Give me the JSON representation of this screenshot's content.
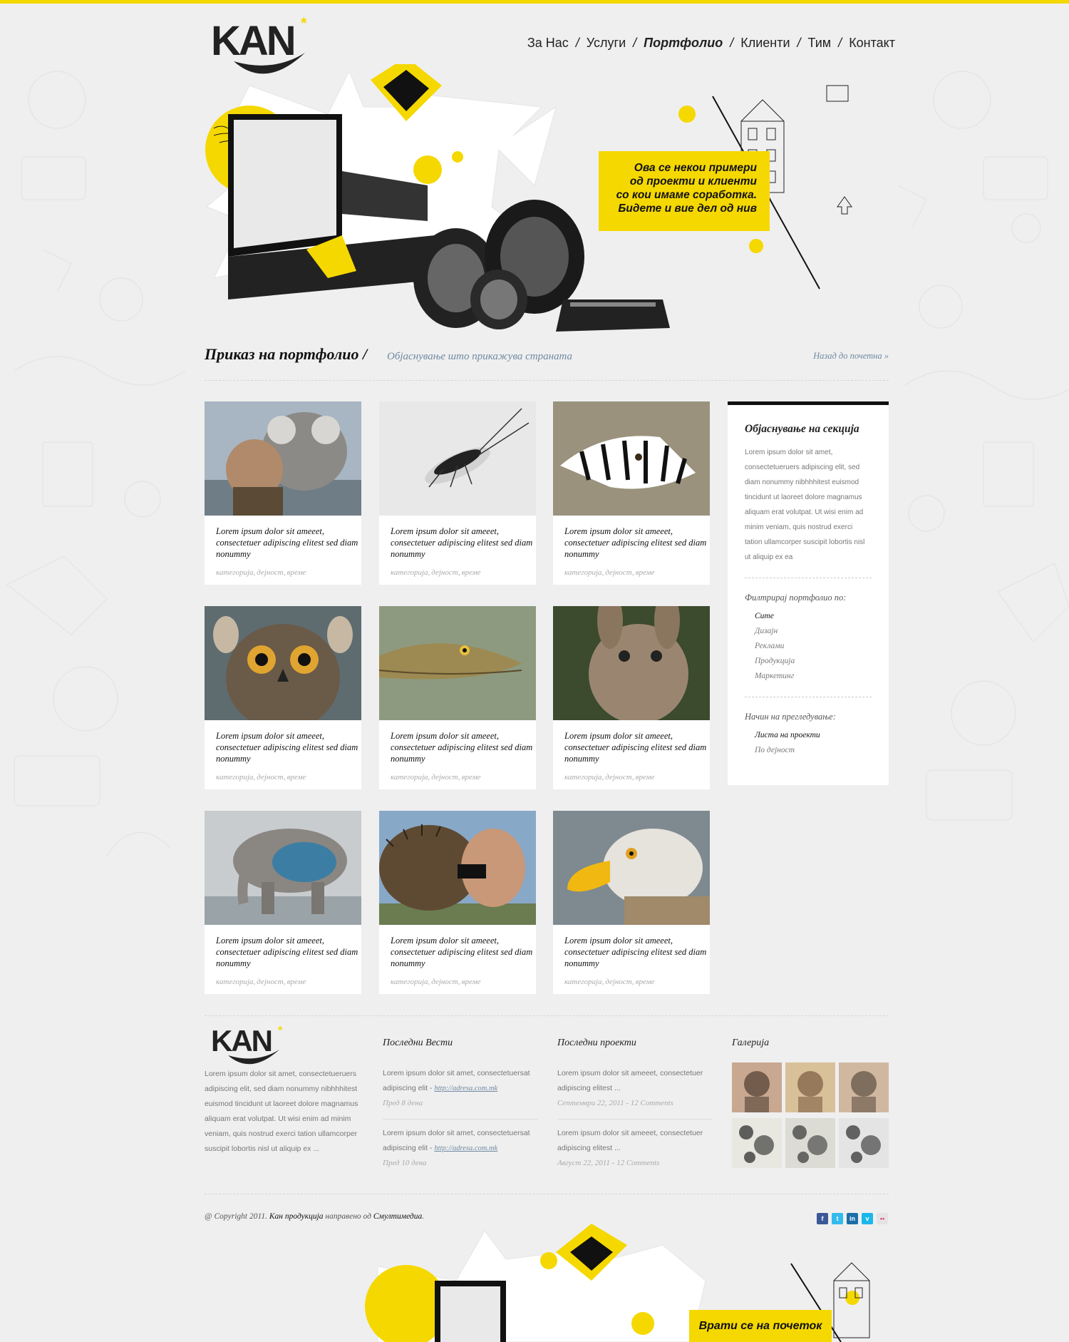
{
  "brand": {
    "logo_text": "KAN",
    "accent": "#f5d800"
  },
  "nav": {
    "items": [
      {
        "label": "За Нас",
        "active": false
      },
      {
        "label": "Услуги",
        "active": false
      },
      {
        "label": "Портфолио",
        "active": true
      },
      {
        "label": "Клиенти",
        "active": false
      },
      {
        "label": "Тим",
        "active": false
      },
      {
        "label": "Контакт",
        "active": false
      }
    ],
    "separator": "/"
  },
  "hero": {
    "callout_lines": [
      "Ова се некои примери",
      "од проекти и клиенти",
      "со кои имаме соработка.",
      "Бидете и вие дел од нив"
    ]
  },
  "section": {
    "title": "Приказ на портфолио /",
    "subtitle": "Објаснување што прикажува страната",
    "back_link": "Назад до почетна »"
  },
  "portfolio": {
    "items": [
      {
        "title": "Lorem ipsum dolor sit ameeet, consectetuer adipiscing elitest sed diam nonummy",
        "meta": [
          "категорија,",
          "дејност,",
          "време"
        ],
        "image": "koala"
      },
      {
        "title": "Lorem ipsum dolor sit ameeet, consectetuer adipiscing elitest sed diam nonummy",
        "meta": [
          "категорија,",
          "дејност,",
          "време"
        ],
        "image": "insect"
      },
      {
        "title": "Lorem ipsum dolor sit ameeet, consectetuer adipiscing elitest sed diam nonummy",
        "meta": [
          "категорија,",
          "дејност,",
          "време"
        ],
        "image": "zebra"
      },
      {
        "title": "Lorem ipsum dolor sit ameeet, consectetuer adipiscing elitest sed diam nonummy",
        "meta": [
          "категорија,",
          "дејност,",
          "време"
        ],
        "image": "owl"
      },
      {
        "title": "Lorem ipsum dolor sit ameeet, consectetuer adipiscing elitest sed diam nonummy",
        "meta": [
          "категорија,",
          "дејност,",
          "време"
        ],
        "image": "crocodile"
      },
      {
        "title": "Lorem ipsum dolor sit ameeet, consectetuer adipiscing elitest sed diam nonummy",
        "meta": [
          "категорија,",
          "дејност,",
          "време"
        ],
        "image": "rabbit"
      },
      {
        "title": "Lorem ipsum dolor sit ameeet, consectetuer adipiscing elitest sed diam nonummy",
        "meta": [
          "категорија,",
          "дејност,",
          "време"
        ],
        "image": "elephant"
      },
      {
        "title": "Lorem ipsum dolor sit ameeet, consectetuer adipiscing elitest sed diam nonummy",
        "meta": [
          "категорија,",
          "дејност,",
          "време"
        ],
        "image": "hedgehog"
      },
      {
        "title": "Lorem ipsum dolor sit ameeet, consectetuer adipiscing elitest sed diam nonummy",
        "meta": [
          "категорија,",
          "дејност,",
          "време"
        ],
        "image": "eagle"
      }
    ]
  },
  "sidebar": {
    "title": "Објаснување на секција",
    "text": "Lorem ipsum dolor sit amet, consectetueruers adipiscing elit, sed diam nonummy nibhhhitest euismod tincidunt ut laoreet dolore magnamus aliquam erat volutpat. Ut wisi enim ad minim veniam, quis nostrud exerci tation ullamcorper suscipit lobortis nisl ut aliquip ex ea",
    "filter_label": "Филтрирај портфолио по:",
    "filters": [
      {
        "label": "Сите",
        "active": true
      },
      {
        "label": "Дизајн",
        "active": false
      },
      {
        "label": "Реклами",
        "active": false
      },
      {
        "label": "Продукција",
        "active": false
      },
      {
        "label": "Маркетинг",
        "active": false
      }
    ],
    "view_label": "Начин на прегледување:",
    "views": [
      {
        "label": "Листа на проекти",
        "active": true
      },
      {
        "label": "По дејност",
        "active": false
      }
    ]
  },
  "footer": {
    "about": "Lorem ipsum dolor sit amet, consectetueruers adipiscing elit, sed diam nonummy nibhhhitest euismod tincidunt ut laoreet dolore magnamus aliquam erat volutpat. Ut wisi enim ad minim veniam, quis nostrud exerci tation ullamcorper suscipit lobortis nisl ut aliquip ex ...",
    "news": {
      "title": "Последни Вести",
      "items": [
        {
          "text": "Lorem ipsum dolor sit amet, consectetuersat adipiscing elit -",
          "link": "http://adresa.com.mk",
          "date": "Пред 8 дена"
        },
        {
          "text": "Lorem ipsum dolor sit amet, consectetuersat adipiscing elit -",
          "link": "http://adresa.com.mk",
          "date": "Пред 10 дена"
        }
      ]
    },
    "projects": {
      "title": "Последни проекти",
      "items": [
        {
          "text": "Lorem ipsum dolor sit ameeet, consectetuer adipiscing elitest ...",
          "date": "Септември 22, 2011 - 12 Comments"
        },
        {
          "text": "Lorem ipsum dolor sit ameeet, consectetuer adipiscing elitest ...",
          "date": "Август 22, 2011 - 12 Comments"
        }
      ]
    },
    "gallery": {
      "title": "Галерија"
    },
    "copyright_prefix": "@ Copyright 2011.",
    "copyright_company": "Кан продукција",
    "copyright_mid": "направено од",
    "copyright_agency": "Смултимедиа",
    "copyright_end": ".",
    "social": [
      {
        "name": "facebook-icon",
        "color": "#3b5998",
        "glyph": "f"
      },
      {
        "name": "twitter-icon",
        "color": "#33bbee",
        "glyph": "t"
      },
      {
        "name": "linkedin-icon",
        "color": "#1a6ea8",
        "glyph": "in"
      },
      {
        "name": "vimeo-icon",
        "color": "#1ab7ea",
        "glyph": "v"
      },
      {
        "name": "flickr-icon",
        "color": "#e4e4e4",
        "glyph": "••"
      }
    ],
    "to_top": "Врати се на почеток"
  }
}
